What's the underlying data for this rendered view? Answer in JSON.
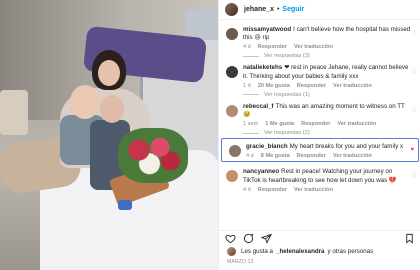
{
  "header": {
    "username": "jehane_x",
    "dot": "•",
    "follow_label": "Seguir"
  },
  "comments": [
    {
      "user": "missamyatwood",
      "text": "I can't believe how the hospital has missed this 😢 rip",
      "time": "4 d",
      "likes": "",
      "reply": "Responder",
      "translate": "Ver traducción",
      "replies": "Ver respuestas (3)",
      "liked": false,
      "highlight": false,
      "avatar_color": "#6d5a4a"
    },
    {
      "user": "natalieketehs",
      "text": "❤ rest in peace Jehane, really cannot believe it. Thinking about your babies & family xxx",
      "time": "1 d",
      "likes": "20 Me gusta",
      "reply": "Responder",
      "translate": "Ver traducción",
      "replies": "Ver respuestas (1)",
      "liked": false,
      "highlight": false,
      "avatar_color": "#3b3b3b"
    },
    {
      "user": "rebeccal_f",
      "text": "This was an amazing moment to witness on TT 🥹",
      "time": "1 sem",
      "likes": "1 Me gusta",
      "reply": "Responder",
      "translate": "Ver traducción",
      "replies": "Ver respuestas (2)",
      "liked": false,
      "highlight": false,
      "avatar_color": "#b08a74"
    },
    {
      "user": "gracie_blanch",
      "text": "My heart breaks for you and your family x",
      "time": "4 d",
      "likes": "8 Me gusta",
      "reply": "Responder",
      "translate": "Ver traducción",
      "replies": "",
      "liked": true,
      "highlight": true,
      "avatar_color": "#8a7464"
    },
    {
      "user": "nancyanneo",
      "text": "Rest in peace! Watching your journey on TikTok is heartbreaking to see how let down you was 💔",
      "time": "4 d",
      "likes": "",
      "reply": "Responder",
      "translate": "Ver traducción",
      "replies": "",
      "liked": false,
      "highlight": false,
      "avatar_color": "#c4906a"
    }
  ],
  "likes": {
    "prefix": "Les gusta a",
    "user": "_helenalexandra",
    "suffix": "y otras personas"
  },
  "date": "MARZO 13",
  "icons": [
    "heart-icon",
    "comment-icon",
    "share-icon",
    "bookmark-icon"
  ]
}
